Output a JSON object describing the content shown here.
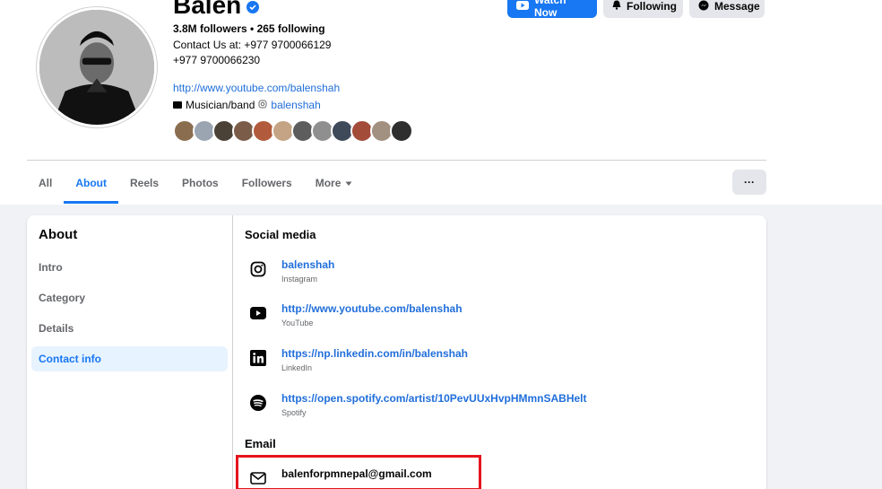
{
  "profile": {
    "name": "Balen",
    "followers": "3.8M followers",
    "separator": "•",
    "following": "265 following",
    "contact_line1": "Contact Us at: +977 9700066129",
    "contact_line2": "+977 9700066230",
    "link": "http://www.youtube.com/balenshah",
    "category": "Musician/band",
    "instagram_handle": "balenshah"
  },
  "actions": {
    "watch": "Watch Now",
    "following": "Following",
    "message": "Message"
  },
  "tabs": [
    {
      "label": "All"
    },
    {
      "label": "About"
    },
    {
      "label": "Reels"
    },
    {
      "label": "Photos"
    },
    {
      "label": "Followers"
    },
    {
      "label": "More"
    }
  ],
  "more_button": "···",
  "about": {
    "title": "About",
    "nav": [
      {
        "label": "Intro"
      },
      {
        "label": "Category"
      },
      {
        "label": "Details"
      },
      {
        "label": "Contact info"
      }
    ],
    "social_title": "Social media",
    "social": [
      {
        "value": "balenshah",
        "label": "Instagram"
      },
      {
        "value": "http://www.youtube.com/balenshah",
        "label": "YouTube"
      },
      {
        "value": "https://np.linkedin.com/in/balenshah",
        "label": "LinkedIn"
      },
      {
        "value": "https://open.spotify.com/artist/10PevUUxHvpHMmnSABHelt",
        "label": "Spotify"
      }
    ],
    "email_title": "Email",
    "email": "balenforpmnepal@gmail.com"
  },
  "colors": {
    "accent": "#1877f2",
    "highlight": "#e4141d"
  }
}
